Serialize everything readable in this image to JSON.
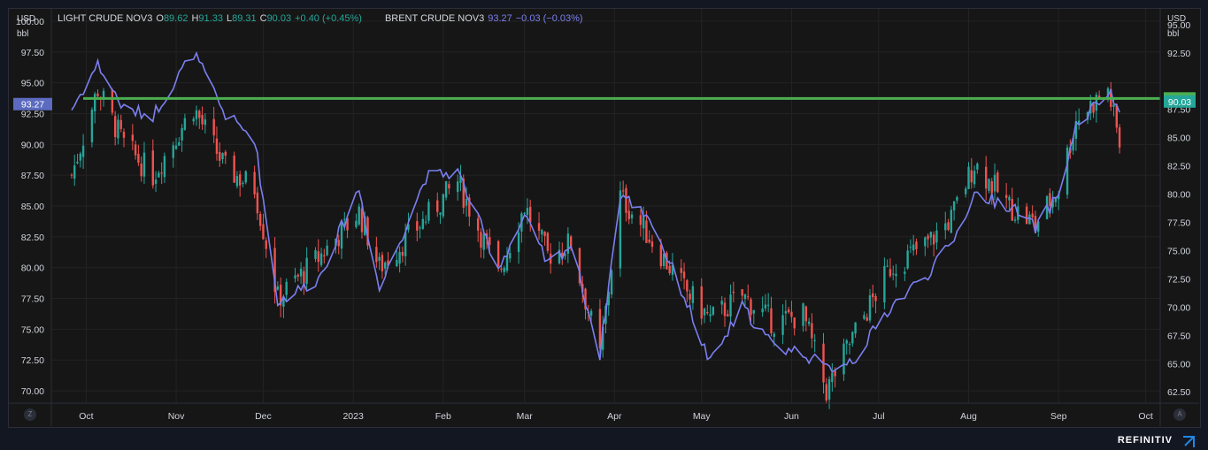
{
  "legend": {
    "light": {
      "name": "LIGHT CRUDE NOV3",
      "o_label": "O",
      "o": "89.62",
      "h_label": "H",
      "h": "91.33",
      "l_label": "L",
      "l": "89.31",
      "c_label": "C",
      "c": "90.03",
      "change": "+0.40 (+0.45%)"
    },
    "brent": {
      "name": "BRENT CRUDE NOV3",
      "value": "93.27",
      "change": "−0.03 (−0.03%)"
    }
  },
  "axes": {
    "left_unit_1": "USD",
    "left_unit_2": "bbl",
    "right_unit_1": "USD",
    "right_unit_2": "bbl",
    "left_ticks": [
      "100.00",
      "97.50",
      "95.00",
      "92.50",
      "90.00",
      "87.50",
      "85.00",
      "82.50",
      "80.00",
      "77.50",
      "75.00",
      "72.50",
      "70.00"
    ],
    "right_ticks": [
      "95.00",
      "92.50",
      "87.50",
      "85.00",
      "82.50",
      "80.00",
      "77.50",
      "75.00",
      "72.50",
      "70.00",
      "67.50",
      "65.00",
      "62.50"
    ],
    "x_ticks": [
      "Oct",
      "Nov",
      "Dec",
      "2023",
      "Feb",
      "Mar",
      "Apr",
      "May",
      "Jun",
      "Jul",
      "Aug",
      "Sep",
      "Oct"
    ]
  },
  "badges": {
    "brent_last": "93.27",
    "hline": "93.73",
    "crude_last": "90.03"
  },
  "corner": {
    "left": "Z",
    "right": "A"
  },
  "branding": "REFINITIV",
  "colors": {
    "up": "#26a69a",
    "down": "#ef5350",
    "brent_line": "#7b7ff0",
    "hline": "#4caf50",
    "background": "#161616"
  },
  "chart_data": {
    "type": "line",
    "title": "",
    "left_axis": {
      "label": "USD bbl",
      "ylim": [
        69,
        101
      ],
      "series": "LIGHT CRUDE NOV3"
    },
    "right_axis": {
      "label": "USD bbl",
      "ylim": [
        61.5,
        96.4
      ],
      "series": "BRENT CRUDE NOV3"
    },
    "x": [
      "2022-09-26",
      "2022-10-05",
      "2022-10-14",
      "2022-10-24",
      "2022-11-07",
      "2022-11-18",
      "2022-11-28",
      "2022-12-06",
      "2022-12-20",
      "2023-01-03",
      "2023-01-10",
      "2023-01-26",
      "2023-02-06",
      "2023-02-20",
      "2023-03-01",
      "2023-03-09",
      "2023-03-17",
      "2023-03-27",
      "2023-04-03",
      "2023-04-13",
      "2023-04-25",
      "2023-05-04",
      "2023-05-15",
      "2023-05-26",
      "2023-06-05",
      "2023-06-13",
      "2023-06-23",
      "2023-07-05",
      "2023-07-18",
      "2023-07-26",
      "2023-08-03",
      "2023-08-15",
      "2023-08-24",
      "2023-09-01",
      "2023-09-07",
      "2023-09-18",
      "2023-09-22"
    ],
    "series": [
      {
        "name": "LIGHT CRUDE NOV3",
        "type": "candlestick",
        "values": [
          87.5,
          94.5,
          90.0,
          87.5,
          93.0,
          88.0,
          86.5,
          77.5,
          80.8,
          84.5,
          80.0,
          84.0,
          87.0,
          79.5,
          85.0,
          81.0,
          82.0,
          72.8,
          85.8,
          82.5,
          78.3,
          75.8,
          77.7,
          75.5,
          76.2,
          70.0,
          74.8,
          80.0,
          82.0,
          84.0,
          88.5,
          85.0,
          83.5,
          86.5,
          92.0,
          94.5,
          90.03
        ]
      },
      {
        "name": "BRENT CRUDE NOV3",
        "type": "line",
        "values": [
          87.5,
          91.5,
          87.5,
          87.0,
          92.5,
          87.0,
          85.0,
          70.5,
          72.5,
          80.5,
          71.5,
          81.5,
          82.0,
          73.5,
          78.0,
          73.8,
          75.5,
          65.8,
          80.0,
          78.0,
          71.0,
          65.0,
          70.0,
          66.5,
          66.0,
          64.5,
          65.5,
          70.0,
          73.0,
          75.5,
          80.0,
          79.0,
          77.0,
          80.0,
          86.0,
          89.0,
          87.5
        ]
      }
    ],
    "hline": 93.73,
    "grid": true,
    "legend_placement": "top-left"
  }
}
